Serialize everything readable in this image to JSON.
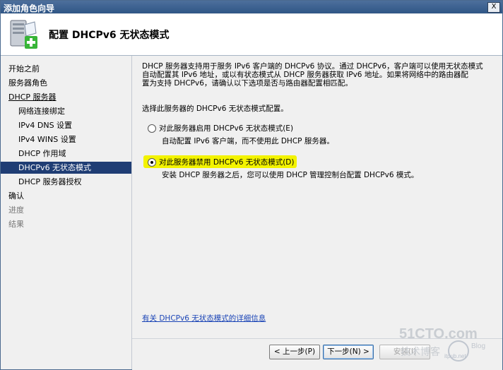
{
  "window": {
    "title": "添加角色向导",
    "close_label": "X"
  },
  "header": {
    "page_title": "配置 DHCPv6 无状态模式",
    "icon": "server-role-add-icon"
  },
  "sidebar": {
    "items": [
      {
        "label": "开始之前",
        "level": 1,
        "state": "normal"
      },
      {
        "label": "服务器角色",
        "level": 1,
        "state": "normal"
      },
      {
        "label": "DHCP 服务器",
        "level": 1,
        "state": "underlined"
      },
      {
        "label": "网络连接绑定",
        "level": 2,
        "state": "normal"
      },
      {
        "label": "IPv4 DNS 设置",
        "level": 2,
        "state": "normal"
      },
      {
        "label": "IPv4 WINS 设置",
        "level": 2,
        "state": "normal"
      },
      {
        "label": "DHCP 作用域",
        "level": 2,
        "state": "normal"
      },
      {
        "label": "DHCPv6 无状态模式",
        "level": 2,
        "state": "selected"
      },
      {
        "label": "DHCP 服务器授权",
        "level": 2,
        "state": "normal"
      },
      {
        "label": "确认",
        "level": 1,
        "state": "normal"
      },
      {
        "label": "进度",
        "level": 1,
        "state": "dimmed"
      },
      {
        "label": "结果",
        "level": 1,
        "state": "dimmed"
      }
    ]
  },
  "content": {
    "description_lines": [
      "DHCP 服务器支持用于服务 IPv6 客户端的 DHCPv6 协议。通过 DHCPv6，客户端可以使用无状态模式",
      "自动配置其 IPv6 地址，或以有状态模式从 DHCP 服务器获取 IPv6 地址。如果将网络中的路由器配",
      "置为支持 DHCPv6，请确认以下选项是否与路由器配置相匹配。"
    ],
    "prompt": "选择此服务器的 DHCPv6 无状态模式配置。",
    "options": [
      {
        "label": "对此服务器启用 DHCPv6 无状态模式(E)",
        "desc": "自动配置 IPv6 客户端，而不使用此 DHCP 服务器。",
        "selected": false
      },
      {
        "label": "对此服务器禁用 DHCPv6 无状态模式(D)",
        "desc": "安装 DHCP 服务器之后，您可以使用 DHCP 管理控制台配置 DHCPv6 模式。",
        "selected": true
      }
    ],
    "more_info_link": "有关 DHCPv6 无状态模式的详细信息"
  },
  "footer": {
    "back_label": "< 上一步(P)",
    "next_label": "下一步(N) >",
    "install_label": "安装(I)"
  },
  "watermark": {
    "line1": "51CTO.com",
    "line2": "技术博客",
    "line3": "itpub.net",
    "line4": "Blog"
  },
  "colors": {
    "selection": "#1f3d74",
    "highlight": "#f3f300",
    "link": "#1a44b6"
  }
}
